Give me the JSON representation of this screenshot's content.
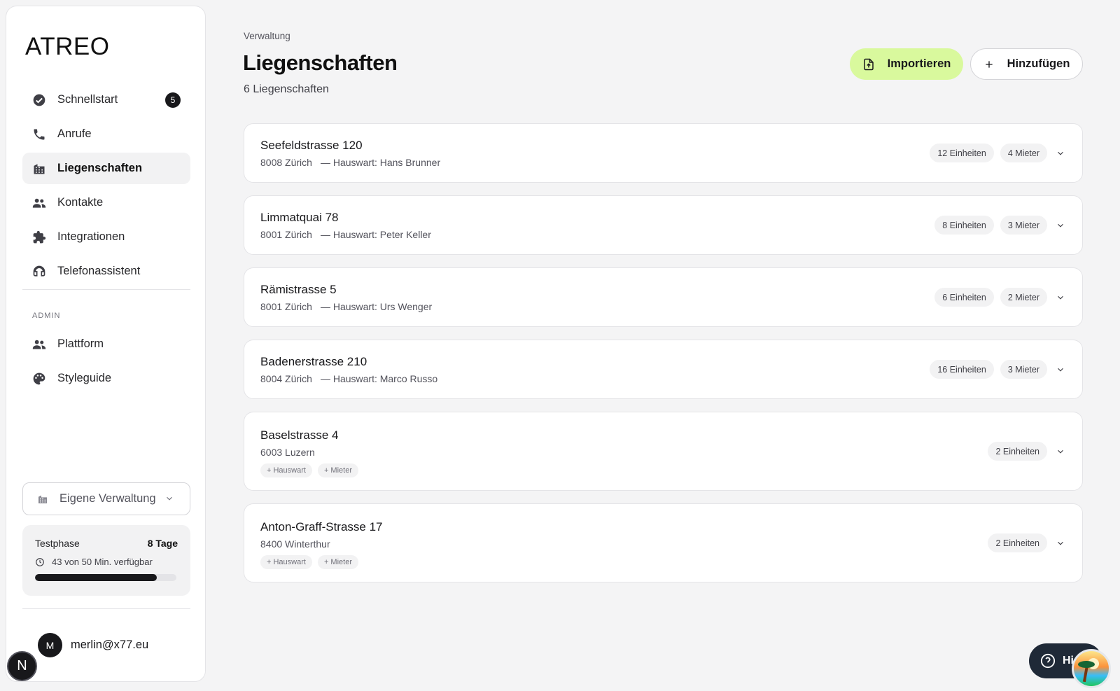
{
  "app": {
    "logo": "ATREO"
  },
  "sidebar": {
    "nav": [
      {
        "label": "Schnellstart",
        "icon": "check-circle-icon",
        "badge": "5"
      },
      {
        "label": "Anrufe",
        "icon": "phone-icon"
      },
      {
        "label": "Liegenschaften",
        "icon": "building-icon",
        "active": true
      },
      {
        "label": "Kontakte",
        "icon": "people-icon"
      },
      {
        "label": "Integrationen",
        "icon": "puzzle-icon"
      },
      {
        "label": "Telefonassistent",
        "icon": "headset-icon"
      }
    ],
    "admin_label": "ADMIN",
    "admin_nav": [
      {
        "label": "Plattform",
        "icon": "people-icon"
      },
      {
        "label": "Styleguide",
        "icon": "palette-icon"
      }
    ],
    "org_select": "Eigene Verwaltung",
    "trial": {
      "title": "Testphase",
      "days": "8 Tage",
      "info": "43 von 50 Min. verfügbar",
      "progress": 0.86
    },
    "user": {
      "initial": "M",
      "email": "merlin@x77.eu"
    },
    "next_badge": "N"
  },
  "main": {
    "breadcrumb": "Verwaltung",
    "title": "Liegenschaften",
    "count": "6 Liegenschaften",
    "import_label": "Importieren",
    "add_label": "Hinzufügen",
    "properties": [
      {
        "name": "Seefeldstrasse 120",
        "location": "8008 Zürich",
        "caretaker": "— Hauswart: Hans Brunner",
        "units": "12 Einheiten",
        "tenants": "4 Mieter"
      },
      {
        "name": "Limmatquai 78",
        "location": "8001 Zürich",
        "caretaker": "— Hauswart: Peter Keller",
        "units": "8 Einheiten",
        "tenants": "3 Mieter"
      },
      {
        "name": "Rämistrasse 5",
        "location": "8001 Zürich",
        "caretaker": "— Hauswart: Urs Wenger",
        "units": "6 Einheiten",
        "tenants": "2 Mieter"
      },
      {
        "name": "Badenerstrasse 210",
        "location": "8004 Zürich",
        "caretaker": "— Hauswart: Marco Russo",
        "units": "16 Einheiten",
        "tenants": "3 Mieter"
      },
      {
        "name": "Baselstrasse 4",
        "location": "6003 Luzern",
        "units": "2 Einheiten",
        "add_caretaker": "+ Hauswart",
        "add_tenant": "+ Mieter"
      },
      {
        "name": "Anton-Graff-Strasse 17",
        "location": "8400 Winterthur",
        "units": "2 Einheiten",
        "add_caretaker": "+ Hauswart",
        "add_tenant": "+ Mieter"
      }
    ]
  },
  "help": {
    "label": "Hi"
  }
}
